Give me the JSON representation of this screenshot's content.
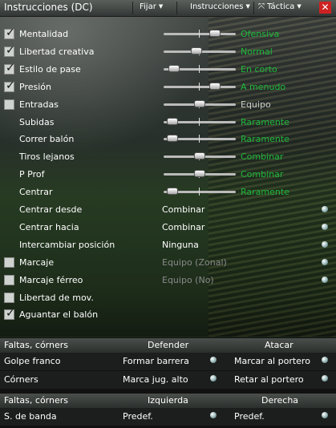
{
  "window": {
    "title": "Instrucciones (DC)",
    "menus": [
      {
        "label": "Fijar"
      },
      {
        "label": "Instrucciones"
      },
      {
        "label": "Táctica"
      }
    ],
    "close_symbol": "✕"
  },
  "instructions": [
    {
      "label": "Mentalidad",
      "checked": true,
      "type": "slider",
      "level": 0.75,
      "value": "Ofensiva",
      "value_style": "green"
    },
    {
      "label": "Libertad creativa",
      "checked": true,
      "type": "slider",
      "level": 0.45,
      "value": "Normal",
      "value_style": "green"
    },
    {
      "label": "Estilo de pase",
      "checked": true,
      "type": "slider",
      "level": 0.08,
      "value": "En corto",
      "value_style": "green"
    },
    {
      "label": "Presión",
      "checked": true,
      "type": "slider",
      "level": 0.75,
      "value": "A menudo",
      "value_style": "green"
    },
    {
      "label": "Entradas",
      "checked": false,
      "type": "slider",
      "level": 0.5,
      "value": "Equipo",
      "value_style": "grey"
    },
    {
      "label": "Subidas",
      "checked": null,
      "type": "slider",
      "level": 0.05,
      "value": "Raramente",
      "value_style": "green"
    },
    {
      "label": "Correr balón",
      "checked": null,
      "type": "slider",
      "level": 0.05,
      "value": "Raramente",
      "value_style": "green"
    },
    {
      "label": "Tiros lejanos",
      "checked": null,
      "type": "slider",
      "level": 0.5,
      "value": "Combinar",
      "value_style": "green"
    },
    {
      "label": "P Prof",
      "checked": null,
      "type": "slider",
      "level": 0.5,
      "value": "Combinar",
      "value_style": "green"
    },
    {
      "label": "Centrar",
      "checked": null,
      "type": "slider",
      "level": 0.05,
      "value": "Raramente",
      "value_style": "green"
    },
    {
      "label": "Centrar desde",
      "checked": null,
      "type": "dropdown",
      "value": "Combinar",
      "value_style": "white"
    },
    {
      "label": "Centrar hacia",
      "checked": null,
      "type": "dropdown",
      "value": "Combinar",
      "value_style": "white"
    },
    {
      "label": "Intercambiar posición",
      "checked": null,
      "type": "dropdown",
      "value": "Ninguna",
      "value_style": "white"
    },
    {
      "label": "Marcaje",
      "checked": false,
      "type": "dropdown",
      "value": "Equipo (Zonal)",
      "value_style": "dim"
    },
    {
      "label": "Marcaje férreo",
      "checked": false,
      "type": "dropdown",
      "value": "Equipo (No)",
      "value_style": "dim"
    },
    {
      "label": "Libertad de mov.",
      "checked": false,
      "type": "none",
      "value": "",
      "value_style": "dim"
    },
    {
      "label": "Aguantar el balón",
      "checked": true,
      "type": "none",
      "value": "",
      "value_style": "dim"
    }
  ],
  "set_pieces": {
    "header1": {
      "title": "Faltas, córners",
      "col1": "Defender",
      "col2": "Atacar"
    },
    "rows1": [
      {
        "label": "Golpe franco",
        "col1": "Formar barrera",
        "col2": "Marcar al portero"
      },
      {
        "label": "Córners",
        "col1": "Marca jug. alto",
        "col2": "Retar al portero"
      }
    ],
    "header2": {
      "title": "Faltas, córners",
      "col1": "Izquierda",
      "col2": "Derecha"
    },
    "rows2": [
      {
        "label": "S. de banda",
        "col1": "Predef.",
        "col2": "Predef."
      }
    ]
  },
  "colors": {
    "green_value": "#1db83b",
    "close": "#cc2222"
  }
}
